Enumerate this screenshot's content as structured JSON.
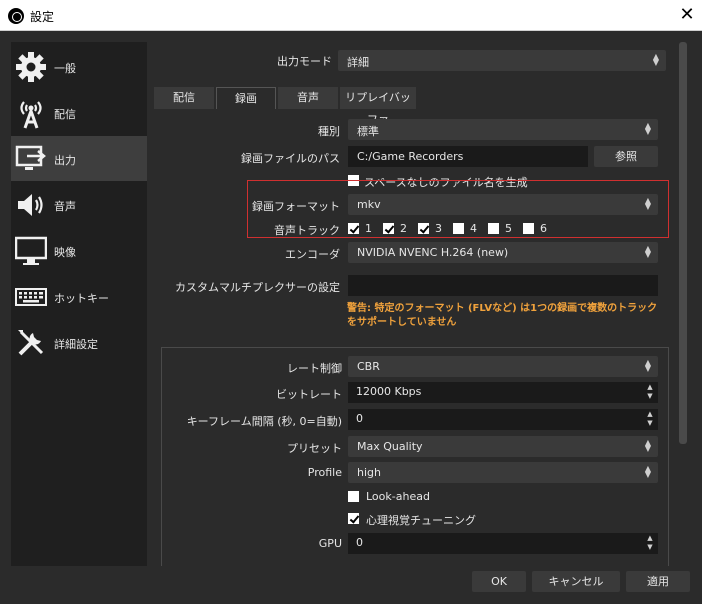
{
  "window": {
    "title": "設定",
    "close_symbol": "✕"
  },
  "sidebar": {
    "items": [
      {
        "label": "一般",
        "icon": "gear-icon"
      },
      {
        "label": "配信",
        "icon": "antenna-icon"
      },
      {
        "label": "出力",
        "icon": "output-icon",
        "active": true
      },
      {
        "label": "音声",
        "icon": "speaker-icon"
      },
      {
        "label": "映像",
        "icon": "monitor-icon"
      },
      {
        "label": "ホットキー",
        "icon": "keyboard-icon"
      },
      {
        "label": "詳細設定",
        "icon": "tools-icon"
      }
    ]
  },
  "output_mode": {
    "label": "出力モード",
    "value": "詳細"
  },
  "tabs": [
    {
      "label": "配信"
    },
    {
      "label": "録画",
      "active": true
    },
    {
      "label": "音声"
    },
    {
      "label": "リプレイバッファ"
    }
  ],
  "recording": {
    "type": {
      "label": "種別",
      "value": "標準"
    },
    "path": {
      "label": "録画ファイルのパス",
      "value": "C:/Game Recorders",
      "browse": "参照"
    },
    "no_space": {
      "label": "スペースなしのファイル名を生成",
      "checked": false
    },
    "format": {
      "label": "録画フォーマット",
      "value": "mkv"
    },
    "audio_track": {
      "label": "音声トラック",
      "tracks": [
        {
          "n": "1",
          "checked": true
        },
        {
          "n": "2",
          "checked": true
        },
        {
          "n": "3",
          "checked": true
        },
        {
          "n": "4",
          "checked": false
        },
        {
          "n": "5",
          "checked": false
        },
        {
          "n": "6",
          "checked": false
        }
      ]
    },
    "encoder": {
      "label": "エンコーダ",
      "value": "NVIDIA NVENC H.264 (new)"
    },
    "muxer": {
      "label": "カスタムマルチプレクサーの設定",
      "value": ""
    },
    "warning": "警告: 特定のフォーマット (FLVなど) は1つの録画で複数のトラックをサポートしていません"
  },
  "encoder_settings": {
    "rate_control": {
      "label": "レート制御",
      "value": "CBR"
    },
    "bitrate": {
      "label": "ビットレート",
      "value": "12000 Kbps"
    },
    "keyframe": {
      "label": "キーフレーム間隔 (秒, 0=自動)",
      "value": "0"
    },
    "preset": {
      "label": "プリセット",
      "value": "Max Quality"
    },
    "profile": {
      "label": "Profile",
      "value": "high"
    },
    "look_ahead": {
      "label": "Look-ahead",
      "checked": false
    },
    "psycho_visual": {
      "label": "心理視覚チューニング",
      "checked": true
    },
    "gpu": {
      "label": "GPU",
      "value": "0"
    }
  },
  "footer": {
    "ok": "OK",
    "cancel": "キャンセル",
    "apply": "適用"
  }
}
